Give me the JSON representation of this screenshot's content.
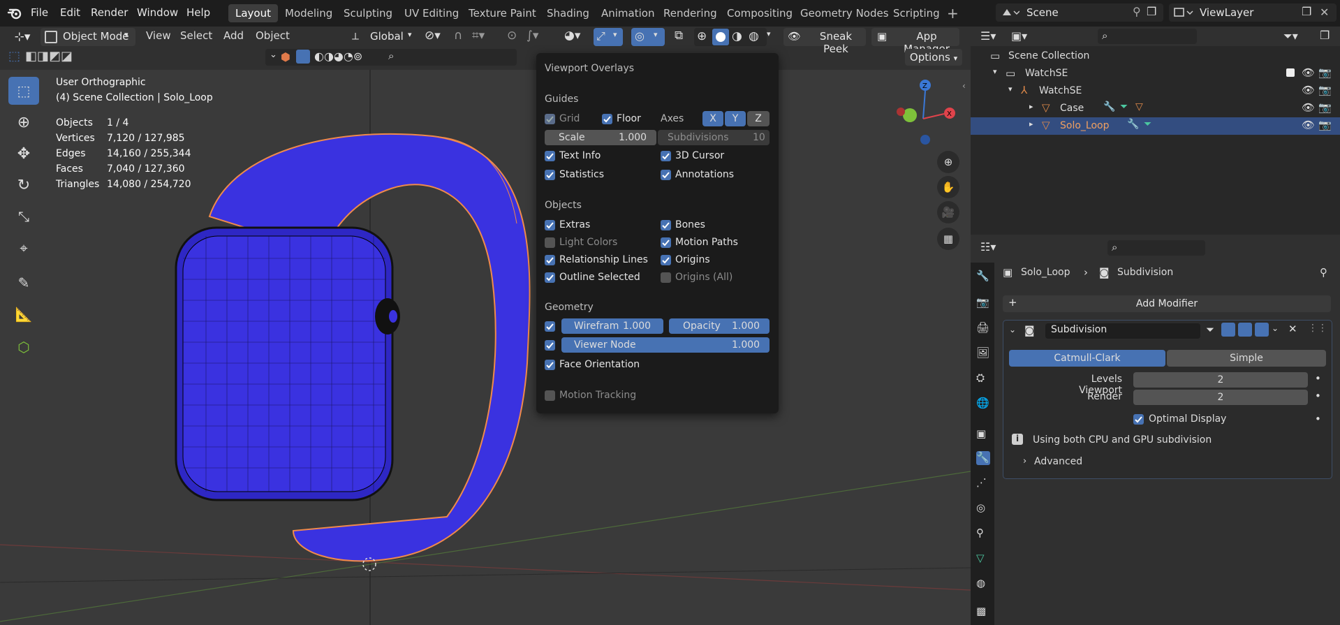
{
  "menu": [
    "File",
    "Edit",
    "Render",
    "Window",
    "Help"
  ],
  "workspaces": [
    "Layout",
    "Modeling",
    "Sculpting",
    "UV Editing",
    "Texture Paint",
    "Shading",
    "Animation",
    "Rendering",
    "Compositing",
    "Geometry Nodes",
    "Scripting"
  ],
  "scene": {
    "label": "Scene",
    "view_layer": "ViewLayer"
  },
  "header": {
    "mode": "Object Mode",
    "view": "View",
    "select": "Select",
    "add": "Add",
    "object": "Object",
    "orientation": "Global",
    "sneak_peek": "Sneak Peek",
    "app_manager": "App Manager",
    "options": "Options"
  },
  "viewport": {
    "view_name": "User Orthographic",
    "collection": "(4) Scene Collection | Solo_Loop",
    "stats": [
      {
        "label": "Objects",
        "value": "1 / 4"
      },
      {
        "label": "Vertices",
        "value": "7,120 / 127,985"
      },
      {
        "label": "Edges",
        "value": "14,160 / 255,344"
      },
      {
        "label": "Faces",
        "value": "7,040 / 127,360"
      },
      {
        "label": "Triangles",
        "value": "14,080 / 254,720"
      }
    ]
  },
  "overlays": {
    "title": "Viewport Overlays",
    "guides": {
      "heading": "Guides",
      "grid": "Grid",
      "floor": "Floor",
      "axes": "Axes",
      "x": "X",
      "y": "Y",
      "z": "Z",
      "scale_label": "Scale",
      "scale_value": "1.000",
      "subdiv_label": "Subdivisions",
      "subdiv_value": "10",
      "text_info": "Text Info",
      "cursor": "3D Cursor",
      "statistics": "Statistics",
      "annotations": "Annotations"
    },
    "objects": {
      "heading": "Objects",
      "extras": "Extras",
      "bones": "Bones",
      "light_colors": "Light Colors",
      "motion_paths": "Motion Paths",
      "relationship_lines": "Relationship Lines",
      "origins": "Origins",
      "outline_selected": "Outline Selected",
      "origins_all": "Origins (All)"
    },
    "geometry": {
      "heading": "Geometry",
      "wireframe_label": "Wirefram",
      "wireframe_value": "1.000",
      "opacity_label": "Opacity",
      "opacity_value": "1.000",
      "viewer_node_label": "Viewer Node",
      "viewer_node_value": "1.000",
      "face_orientation": "Face Orientation",
      "motion_tracking": "Motion Tracking"
    }
  },
  "outliner": {
    "root": "Scene Collection",
    "items": [
      {
        "name": "WatchSE",
        "level": 1
      },
      {
        "name": "WatchSE",
        "level": 2
      },
      {
        "name": "Case",
        "level": 3
      },
      {
        "name": "Solo_Loop",
        "level": 3
      }
    ]
  },
  "properties": {
    "breadcrumb_object": "Solo_Loop",
    "breadcrumb_modifier": "Subdivision",
    "add_modifier": "Add Modifier",
    "modifier_name": "Subdivision",
    "catmull": "Catmull-Clark",
    "simple": "Simple",
    "levels_viewport_label": "Levels Viewport",
    "levels_viewport_value": "2",
    "render_label": "Render",
    "render_value": "2",
    "optimal_display": "Optimal Display",
    "info": "Using both CPU and GPU subdivision",
    "advanced": "Advanced"
  },
  "colors": {
    "accent": "#4772b3",
    "selected_row": "#334d80",
    "mesh": "#3a32e0",
    "wire": "#f08a4b"
  }
}
